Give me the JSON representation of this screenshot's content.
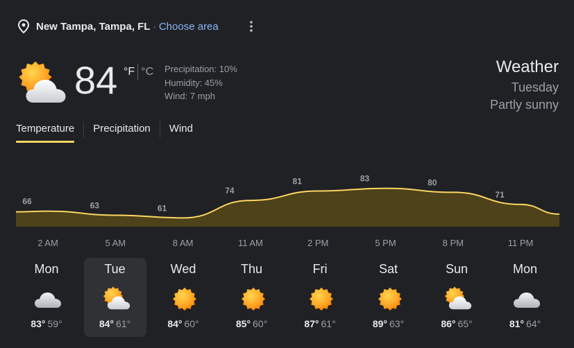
{
  "location": {
    "place": "New Tampa, Tampa, FL",
    "separator": "·",
    "choose_area": "Choose area"
  },
  "current": {
    "temp": "84",
    "unit_f": "°F",
    "unit_c": "°C",
    "precipitation": "Precipitation: 10%",
    "humidity": "Humidity: 45%",
    "wind": "Wind: 7 mph",
    "icon": "partly-cloudy-icon"
  },
  "header": {
    "title": "Weather",
    "day": "Tuesday",
    "condition": "Partly sunny"
  },
  "tabs": [
    {
      "label": "Temperature",
      "active": true
    },
    {
      "label": "Precipitation",
      "active": false
    },
    {
      "label": "Wind",
      "active": false
    }
  ],
  "colors": {
    "accent": "#fdd663",
    "area_fill": "#4d4219",
    "link": "#8ab4f8",
    "background": "#202124"
  },
  "chart_data": {
    "type": "area",
    "x": [
      "2 AM",
      "5 AM",
      "8 AM",
      "11 AM",
      "2 PM",
      "5 PM",
      "8 PM",
      "11 PM"
    ],
    "values": [
      66,
      63,
      61,
      74,
      81,
      83,
      80,
      71
    ],
    "labels": [
      "66",
      "63",
      "61",
      "74",
      "81",
      "83",
      "80",
      "71"
    ]
  },
  "days": [
    {
      "name": "Mon",
      "high": "83°",
      "low": "59°",
      "icon": "cloudy-icon",
      "selected": false
    },
    {
      "name": "Tue",
      "high": "84°",
      "low": "61°",
      "icon": "partly-cloudy-icon",
      "selected": true
    },
    {
      "name": "Wed",
      "high": "84°",
      "low": "60°",
      "icon": "sunny-icon",
      "selected": false
    },
    {
      "name": "Thu",
      "high": "85°",
      "low": "60°",
      "icon": "sunny-icon",
      "selected": false
    },
    {
      "name": "Fri",
      "high": "87°",
      "low": "61°",
      "icon": "sunny-icon",
      "selected": false
    },
    {
      "name": "Sat",
      "high": "89°",
      "low": "63°",
      "icon": "sunny-icon",
      "selected": false
    },
    {
      "name": "Sun",
      "high": "86°",
      "low": "65°",
      "icon": "partly-cloudy-icon",
      "selected": false
    },
    {
      "name": "Mon",
      "high": "81°",
      "low": "64°",
      "icon": "cloudy-icon",
      "selected": false
    }
  ]
}
